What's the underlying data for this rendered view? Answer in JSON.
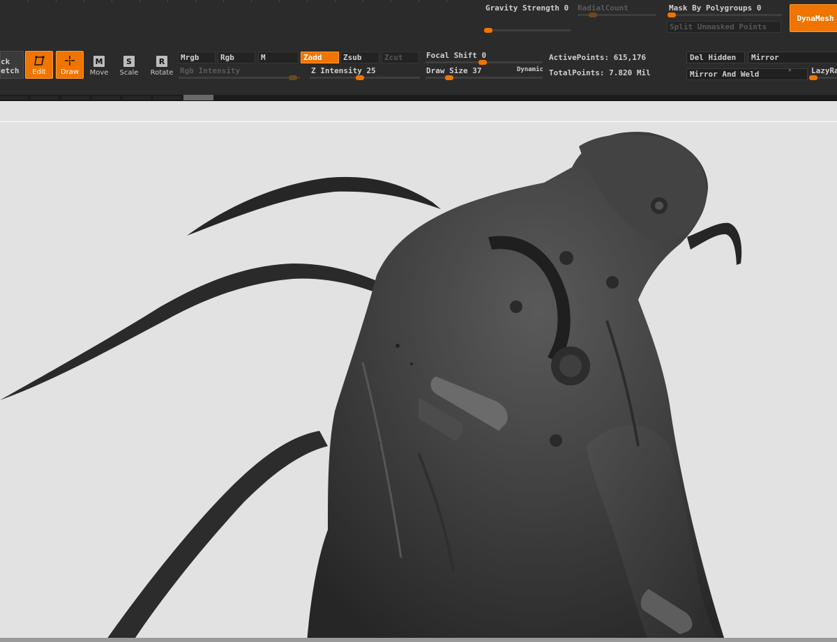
{
  "top_panel": {
    "gravity_strength": "Gravity Strength 0",
    "radial_count": "RadialCount",
    "mask_by_polygroups": "Mask By Polygroups 0",
    "split_unmasked_points": "Split Unmasked Points",
    "dynamesh": "DynaMesh"
  },
  "tools": {
    "sketch_line1": "ck",
    "sketch_line2": "etch",
    "edit": "Edit",
    "draw": "Draw",
    "move": "Move",
    "move_key": "M",
    "scale": "Scale",
    "scale_key": "S",
    "rotate": "Rotate",
    "rotate_key": "R"
  },
  "color_modes": {
    "mrgb": "Mrgb",
    "rgb": "Rgb",
    "m": "M",
    "rgb_intensity": "Rgb Intensity"
  },
  "depth_modes": {
    "zadd": "Zadd",
    "zsub": "Zsub",
    "zcut": "Zcut",
    "z_intensity": "Z Intensity 25",
    "z_intensity_value": 25
  },
  "brush": {
    "focal_shift": "Focal Shift 0",
    "draw_size": "Draw Size 37",
    "dynamic": "Dynamic"
  },
  "stats": {
    "active_points": "ActivePoints: 615,176",
    "total_points": "TotalPoints: 7.820 Mil"
  },
  "geometry": {
    "del_hidden": "Del Hidden",
    "mirror": "Mirror",
    "mirror_and_weld": "Mirror And Weld",
    "lazy_radius": "LazyRa"
  },
  "colors": {
    "accent": "#f07400",
    "panel": "#2b2b2b",
    "canvas": "#e2e2e2",
    "model": "#3c3c3c"
  },
  "viewport": {
    "subject": "sculpted creature mesh"
  }
}
